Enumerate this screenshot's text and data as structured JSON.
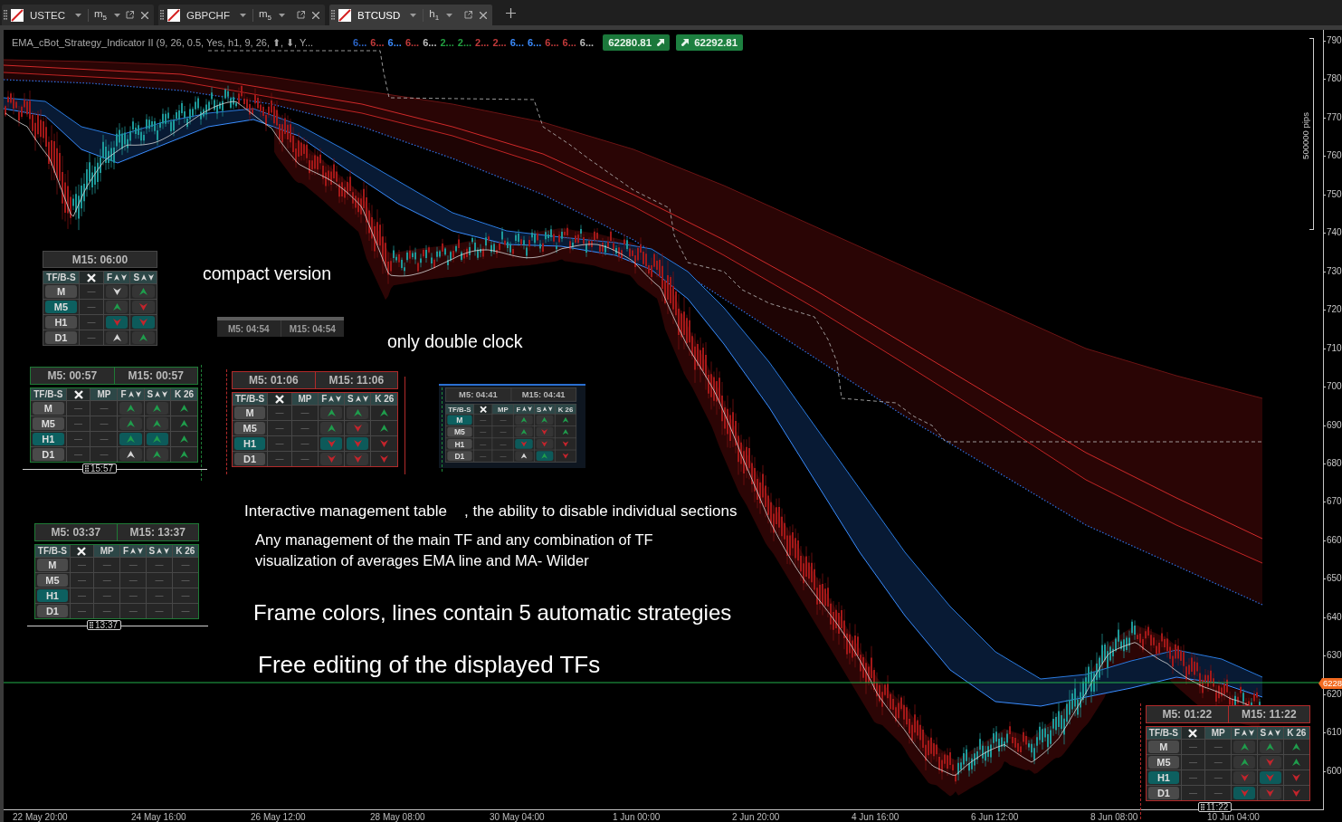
{
  "tabs": [
    {
      "symbol": "USTEC",
      "timeframe": "m$_{5}$",
      "selected": false
    },
    {
      "symbol": "GBPCHF",
      "timeframe": "m$_{5}$",
      "selected": false
    },
    {
      "symbol": "BTCUSD",
      "timeframe": "h$_{1}$",
      "selected": true
    }
  ],
  "indicator": {
    "label": "EMA_cBot_Strategy_Indicator II (9, 26, 0.5, Yes, h1, 9, 26, ⬆, ⬇, Y...",
    "values": [
      {
        "text": "6...",
        "color": "#2a63c4"
      },
      {
        "text": "6...",
        "color": "#c23a3a"
      },
      {
        "text": "6...",
        "color": "#3b8cff"
      },
      {
        "text": "6...",
        "color": "#c23a3a"
      },
      {
        "text": "6...",
        "color": "#bfbfbf"
      },
      {
        "text": "2...",
        "color": "#22a040"
      },
      {
        "text": "2...",
        "color": "#22a040"
      },
      {
        "text": "2...",
        "color": "#c23a3a"
      },
      {
        "text": "2...",
        "color": "#c23a3a"
      },
      {
        "text": "6...",
        "color": "#3b8cff"
      },
      {
        "text": "6...",
        "color": "#3b8cff"
      },
      {
        "text": "6...",
        "color": "#c23a3a"
      },
      {
        "text": "6...",
        "color": "#c23a3a"
      },
      {
        "text": "6...",
        "color": "#bfbfbf"
      }
    ]
  },
  "trade_buttons": [
    {
      "kind": "sell",
      "price": "62280.81"
    },
    {
      "kind": "buy",
      "price": "62292.81"
    }
  ],
  "price_axis": {
    "range_label": "500000 pips",
    "labels": [
      "790",
      "780",
      "770",
      "760",
      "750",
      "740",
      "730",
      "720",
      "710",
      "700",
      "690",
      "680",
      "670",
      "660",
      "650",
      "640",
      "630",
      "620",
      "610",
      "600"
    ],
    "current_price": "6228"
  },
  "time_axis": {
    "labels": [
      "22 May 20:00",
      "24 May 16:00",
      "26 May 12:00",
      "28 May 08:00",
      "30 May 04:00",
      "1 Jun 00:00",
      "2 Jun 20:00",
      "4 Jun 16:00",
      "6 Jun 12:00",
      "8 Jun 08:00",
      "10 Jun 04:00"
    ]
  },
  "notes": [
    "compact version",
    "only double clock",
    "Interactive management table",
    ", the ability to disable individual sections",
    "Any management of the main TF and any combination of TF",
    "visualization of averages EMA line and MA- Wilder",
    "Frame colors, lines contain 5 automatic strategies",
    "Free editing of the displayed TFs"
  ],
  "clock_widget": {
    "clocks": [
      "M5: 04:54",
      "M15: 04:54"
    ]
  },
  "tables": [
    {
      "kind": "compact",
      "clocks": [
        "M15: 06:00"
      ],
      "columns": [
        {
          "kind": "label",
          "label": "TF/B-S"
        },
        {
          "kind": "close"
        },
        {
          "kind": "sort",
          "label": "F"
        },
        {
          "kind": "sort",
          "label": "S"
        }
      ],
      "rows": [
        {
          "cells": [
            {
              "kind": "timeframe",
              "text": "M",
              "selected": false
            },
            {
              "kind": "dash",
              "text": "—"
            },
            {
              "kind": "down",
              "color": "#d6d6d6",
              "active": false
            },
            {
              "kind": "up",
              "color": "#1f9d4c",
              "active": false
            }
          ]
        },
        {
          "cells": [
            {
              "kind": "timeframe",
              "text": "M5",
              "selected": true
            },
            {
              "kind": "dash",
              "text": "—"
            },
            {
              "kind": "up",
              "color": "#1f9d4c",
              "active": false
            },
            {
              "kind": "down",
              "color": "#c4242c",
              "active": false
            }
          ]
        },
        {
          "cells": [
            {
              "kind": "timeframe",
              "text": "H1",
              "selected": false
            },
            {
              "kind": "dash",
              "text": "—"
            },
            {
              "kind": "down",
              "color": "#c4242c",
              "active": true
            },
            {
              "kind": "down",
              "color": "#c4242c",
              "active": true
            }
          ]
        },
        {
          "cells": [
            {
              "kind": "timeframe",
              "text": "D1",
              "selected": false
            },
            {
              "kind": "dash",
              "text": "—"
            },
            {
              "kind": "up",
              "color": "#d6d6d6",
              "active": false
            },
            {
              "kind": "up",
              "color": "#1f9d4c",
              "active": false
            }
          ]
        }
      ]
    },
    {
      "kind": "framed",
      "color": "#1e7a35",
      "clocks": [
        "M5: 00:57",
        "M15: 00:57"
      ],
      "columns": [
        {
          "kind": "label",
          "label": "TF/B-S"
        },
        {
          "kind": "close"
        },
        {
          "kind": "text",
          "label": "MP"
        },
        {
          "kind": "sort",
          "label": "F"
        },
        {
          "kind": "sort",
          "label": "S"
        },
        {
          "kind": "text",
          "label": "K 26"
        }
      ],
      "rows": [
        {
          "cells": [
            {
              "kind": "timeframe",
              "text": "M",
              "selected": false
            },
            {
              "kind": "dash",
              "text": "—"
            },
            {
              "kind": "dash",
              "text": "—"
            },
            {
              "kind": "up",
              "color": "#1f9d4c",
              "active": false
            },
            {
              "kind": "up",
              "color": "#1f9d4c",
              "active": false
            },
            {
              "kind": "up",
              "color": "#1f9d4c"
            }
          ]
        },
        {
          "cells": [
            {
              "kind": "timeframe",
              "text": "M5",
              "selected": false
            },
            {
              "kind": "dash",
              "text": "—"
            },
            {
              "kind": "dash",
              "text": "—"
            },
            {
              "kind": "up",
              "color": "#1f9d4c",
              "active": false
            },
            {
              "kind": "up",
              "color": "#1f9d4c",
              "active": false
            },
            {
              "kind": "up",
              "color": "#1f9d4c"
            }
          ]
        },
        {
          "cells": [
            {
              "kind": "timeframe",
              "text": "H1",
              "selected": true
            },
            {
              "kind": "dash",
              "text": "—"
            },
            {
              "kind": "dash",
              "text": "—"
            },
            {
              "kind": "up",
              "color": "#1f9d4c",
              "active": true
            },
            {
              "kind": "up",
              "color": "#1f9d4c",
              "active": true
            },
            {
              "kind": "up",
              "color": "#1f9d4c"
            }
          ]
        },
        {
          "cells": [
            {
              "kind": "timeframe",
              "text": "D1",
              "selected": false
            },
            {
              "kind": "dash",
              "text": "—"
            },
            {
              "kind": "dash",
              "text": "—"
            },
            {
              "kind": "up",
              "color": "#d6d6d6",
              "active": false
            },
            {
              "kind": "up",
              "color": "#1f9d4c",
              "active": false
            },
            {
              "kind": "up",
              "color": "#1f9d4c"
            }
          ]
        }
      ],
      "time_tag": "15:57"
    },
    {
      "kind": "framed",
      "color": "#b22a2a",
      "clocks": [
        "M5: 01:06",
        "M15: 11:06"
      ],
      "columns": [
        {
          "kind": "label",
          "label": "TF/B-S"
        },
        {
          "kind": "close"
        },
        {
          "kind": "text",
          "label": "MP"
        },
        {
          "kind": "sort",
          "label": "F"
        },
        {
          "kind": "sort",
          "label": "S"
        },
        {
          "kind": "text",
          "label": "K 26"
        }
      ],
      "rows": [
        {
          "cells": [
            {
              "kind": "timeframe",
              "text": "M",
              "selected": false
            },
            {
              "kind": "dash",
              "text": "—"
            },
            {
              "kind": "dash",
              "text": "—"
            },
            {
              "kind": "up",
              "color": "#1f9d4c",
              "active": false
            },
            {
              "kind": "up",
              "color": "#1f9d4c",
              "active": false
            },
            {
              "kind": "up",
              "color": "#1f9d4c"
            }
          ]
        },
        {
          "cells": [
            {
              "kind": "timeframe",
              "text": "M5",
              "selected": false
            },
            {
              "kind": "dash",
              "text": "—"
            },
            {
              "kind": "dash",
              "text": "—"
            },
            {
              "kind": "up",
              "color": "#1f9d4c",
              "active": false
            },
            {
              "kind": "down",
              "color": "#c4242c",
              "active": false
            },
            {
              "kind": "up",
              "color": "#1f9d4c"
            }
          ]
        },
        {
          "cells": [
            {
              "kind": "timeframe",
              "text": "H1",
              "selected": true
            },
            {
              "kind": "dash",
              "text": "—"
            },
            {
              "kind": "dash",
              "text": "—"
            },
            {
              "kind": "down",
              "color": "#c4242c",
              "active": true
            },
            {
              "kind": "down",
              "color": "#c4242c",
              "active": true
            },
            {
              "kind": "down",
              "color": "#c4242c"
            }
          ]
        },
        {
          "cells": [
            {
              "kind": "timeframe",
              "text": "D1",
              "selected": false
            },
            {
              "kind": "dash",
              "text": "—"
            },
            {
              "kind": "dash",
              "text": "—"
            },
            {
              "kind": "down",
              "color": "#c4242c",
              "active": false
            },
            {
              "kind": "down",
              "color": "#c4242c",
              "active": false
            },
            {
              "kind": "down",
              "color": "#c4242c"
            }
          ]
        }
      ]
    },
    {
      "kind": "panel",
      "color": "#2a6fd0",
      "clocks": [
        "M5: 04:41",
        "M15: 04:41"
      ],
      "columns": [
        {
          "kind": "label",
          "label": "TF/B-S"
        },
        {
          "kind": "close"
        },
        {
          "kind": "text",
          "label": "MP"
        },
        {
          "kind": "sort",
          "label": "F"
        },
        {
          "kind": "sort",
          "label": "S"
        },
        {
          "kind": "text",
          "label": "K 26"
        }
      ],
      "rows": [
        {
          "cells": [
            {
              "kind": "timeframe",
              "text": "M",
              "selected": true
            },
            {
              "kind": "dash",
              "text": "—"
            },
            {
              "kind": "dash",
              "text": "—"
            },
            {
              "kind": "up",
              "color": "#1f9d4c",
              "active": false
            },
            {
              "kind": "up",
              "color": "#1f9d4c",
              "active": false
            },
            {
              "kind": "up",
              "color": "#1f9d4c"
            }
          ]
        },
        {
          "cells": [
            {
              "kind": "timeframe",
              "text": "M5",
              "selected": false
            },
            {
              "kind": "dash",
              "text": "—"
            },
            {
              "kind": "dash",
              "text": "—"
            },
            {
              "kind": "up",
              "color": "#1f9d4c",
              "active": false
            },
            {
              "kind": "down",
              "color": "#c4242c",
              "active": false
            },
            {
              "kind": "up",
              "color": "#1f9d4c"
            }
          ]
        },
        {
          "cells": [
            {
              "kind": "timeframe",
              "text": "H1",
              "selected": false
            },
            {
              "kind": "dash",
              "text": "—"
            },
            {
              "kind": "dash",
              "text": "—"
            },
            {
              "kind": "down",
              "color": "#c4242c",
              "active": true
            },
            {
              "kind": "down",
              "color": "#c4242c",
              "active": false
            },
            {
              "kind": "down",
              "color": "#c4242c"
            }
          ]
        },
        {
          "cells": [
            {
              "kind": "timeframe",
              "text": "D1",
              "selected": false
            },
            {
              "kind": "dash",
              "text": "—"
            },
            {
              "kind": "dash",
              "text": "—"
            },
            {
              "kind": "up",
              "color": "#d6d6d6",
              "active": false
            },
            {
              "kind": "up",
              "color": "#1f9d4c",
              "active": true
            },
            {
              "kind": "down",
              "color": "#c4242c"
            }
          ]
        }
      ]
    },
    {
      "kind": "framed",
      "color": "#1e7a35",
      "clocks": [
        "M5: 03:37",
        "M15: 13:37"
      ],
      "columns": [
        {
          "kind": "label",
          "label": "TF/B-S"
        },
        {
          "kind": "close"
        },
        {
          "kind": "text",
          "label": "MP"
        },
        {
          "kind": "sort",
          "label": "F"
        },
        {
          "kind": "sort",
          "label": "S"
        },
        {
          "kind": "text",
          "label": "K 26"
        }
      ],
      "rows": [
        {
          "cells": [
            {
              "kind": "timeframe",
              "text": "M",
              "selected": false
            },
            {
              "kind": "dash",
              "text": "—"
            },
            {
              "kind": "dash",
              "text": "—"
            },
            {
              "kind": "dash",
              "text": "—"
            },
            {
              "kind": "dash",
              "text": "—"
            },
            {
              "kind": "dash",
              "text": "—"
            }
          ]
        },
        {
          "cells": [
            {
              "kind": "timeframe",
              "text": "M5",
              "selected": false
            },
            {
              "kind": "dash",
              "text": "—"
            },
            {
              "kind": "dash",
              "text": "—"
            },
            {
              "kind": "dash",
              "text": "—"
            },
            {
              "kind": "dash",
              "text": "—"
            },
            {
              "kind": "dash",
              "text": "—"
            }
          ]
        },
        {
          "cells": [
            {
              "kind": "timeframe",
              "text": "H1",
              "selected": true
            },
            {
              "kind": "dash",
              "text": "—"
            },
            {
              "kind": "dash",
              "text": "—"
            },
            {
              "kind": "dash",
              "text": "—"
            },
            {
              "kind": "dash",
              "text": "—"
            },
            {
              "kind": "dash",
              "text": "—"
            }
          ]
        },
        {
          "cells": [
            {
              "kind": "timeframe",
              "text": "D1",
              "selected": false
            },
            {
              "kind": "dash",
              "text": "—"
            },
            {
              "kind": "dash",
              "text": "—"
            },
            {
              "kind": "dash",
              "text": "—"
            },
            {
              "kind": "dash",
              "text": "—"
            },
            {
              "kind": "dash",
              "text": "—"
            }
          ]
        }
      ],
      "time_tag": "13:37"
    },
    {
      "kind": "framed",
      "color": "#b22a2a",
      "clocks": [
        "M5: 01:22",
        "M15: 11:22"
      ],
      "columns": [
        {
          "kind": "label",
          "label": "TF/B-S"
        },
        {
          "kind": "close"
        },
        {
          "kind": "text",
          "label": "MP"
        },
        {
          "kind": "sort",
          "label": "F"
        },
        {
          "kind": "sort",
          "label": "S"
        },
        {
          "kind": "text",
          "label": "K 26"
        }
      ],
      "rows": [
        {
          "cells": [
            {
              "kind": "timeframe",
              "text": "M",
              "selected": false
            },
            {
              "kind": "dash",
              "text": "—"
            },
            {
              "kind": "dash",
              "text": "—"
            },
            {
              "kind": "up",
              "color": "#1f9d4c",
              "active": false
            },
            {
              "kind": "up",
              "color": "#1f9d4c",
              "active": false
            },
            {
              "kind": "up",
              "color": "#1f9d4c"
            }
          ]
        },
        {
          "cells": [
            {
              "kind": "timeframe",
              "text": "M5",
              "selected": false
            },
            {
              "kind": "dash",
              "text": "—"
            },
            {
              "kind": "dash",
              "text": "—"
            },
            {
              "kind": "up",
              "color": "#1f9d4c",
              "active": false
            },
            {
              "kind": "down",
              "color": "#c4242c",
              "active": false
            },
            {
              "kind": "up",
              "color": "#1f9d4c"
            }
          ]
        },
        {
          "cells": [
            {
              "kind": "timeframe",
              "text": "H1",
              "selected": true
            },
            {
              "kind": "dash",
              "text": "—"
            },
            {
              "kind": "dash",
              "text": "—"
            },
            {
              "kind": "down",
              "color": "#c4242c",
              "active": false
            },
            {
              "kind": "down",
              "color": "#c4242c",
              "active": true
            },
            {
              "kind": "down",
              "color": "#c4242c"
            }
          ]
        },
        {
          "cells": [
            {
              "kind": "timeframe",
              "text": "D1",
              "selected": false
            },
            {
              "kind": "dash",
              "text": "—"
            },
            {
              "kind": "dash",
              "text": "—"
            },
            {
              "kind": "down",
              "color": "#c4242c",
              "active": true
            },
            {
              "kind": "down",
              "color": "#c4242c",
              "active": false
            },
            {
              "kind": "down",
              "color": "#c4242c"
            }
          ]
        }
      ],
      "time_tag": "11:22"
    }
  ]
}
